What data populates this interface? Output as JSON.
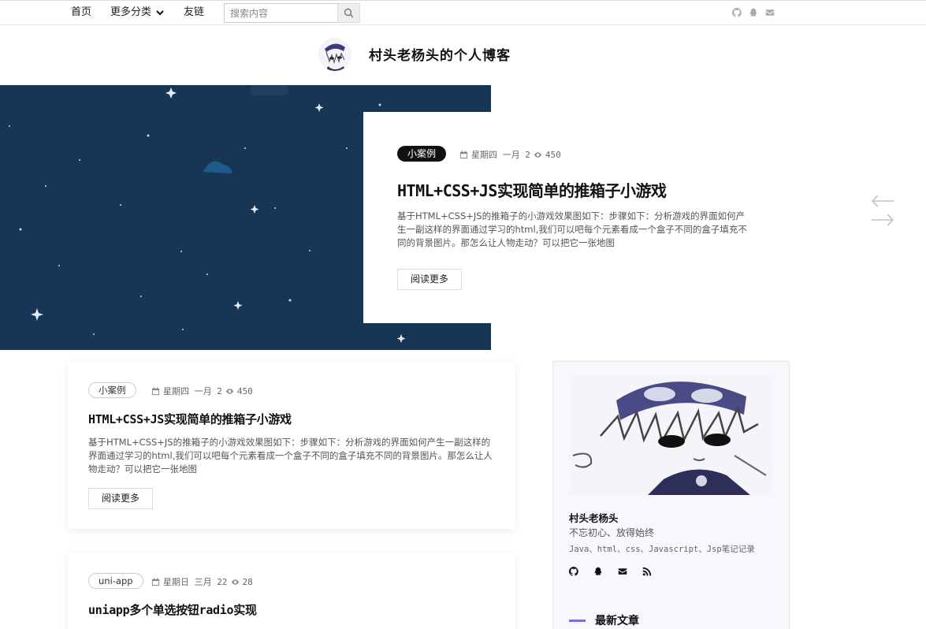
{
  "nav": {
    "home": "首页",
    "more": "更多分类",
    "links": "友链",
    "search_placeholder": "搜索内容"
  },
  "icons": {
    "top_social": [
      "github-icon",
      "qq-icon",
      "mail-icon"
    ],
    "side_social": [
      "github-icon",
      "qq-icon",
      "mail-icon",
      "rss-icon"
    ]
  },
  "header": {
    "title": "村头老杨头的个人博客"
  },
  "hero": {
    "tag": "小案例",
    "date": "星期四 一月 2",
    "views": "450",
    "title": "HTML+CSS+JS实现简单的推箱子小游戏",
    "excerpt": "基于HTML+CSS+JS的推箱子的小游戏效果图如下：步骤如下：分析游戏的界面如何产生一副这样的界面通过学习的html,我们可以吧每个元素看成一个盒子不同的盒子填充不同的背景图片。那怎么让人物走动？可以把它一张地图",
    "button": "阅读更多"
  },
  "posts": [
    {
      "tag": "小案例",
      "date": "星期四 一月 2",
      "views": "450",
      "title": "HTML+CSS+JS实现简单的推箱子小游戏",
      "excerpt": "基于HTML+CSS+JS的推箱子的小游戏效果图如下：步骤如下：分析游戏的界面如何产生一副这样的界面通过学习的html,我们可以吧每个元素看成一个盒子不同的盒子填充不同的背景图片。那怎么让人物走动？可以把它一张地图",
      "button": "阅读更多"
    },
    {
      "tag": "uni-app",
      "date": "星期日 三月 22",
      "views": "28",
      "title": "uniapp多个单选按钮radio实现"
    }
  ],
  "sidebar": {
    "name": "村头老杨头",
    "motto": "不忘初心、放得始终",
    "desc": "Java、html、css、Javascript、Jsp笔记记录",
    "latest_heading": "最新文章"
  },
  "colors": {
    "hero_bg": "#173656",
    "accent": "#7b6fe0"
  }
}
